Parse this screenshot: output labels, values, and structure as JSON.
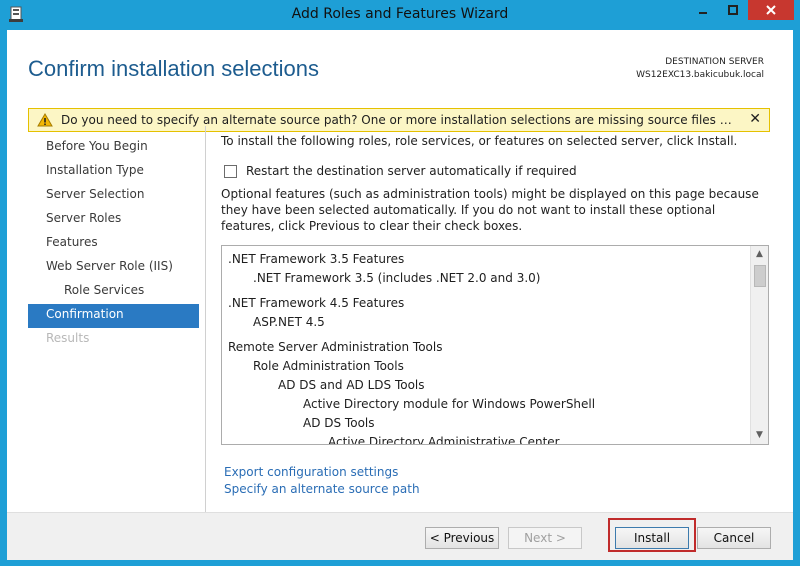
{
  "window": {
    "title": "Add Roles and Features Wizard",
    "accent_color": "#1e9fd6",
    "close_color": "#c7372f"
  },
  "header": {
    "title": "Confirm installation selections",
    "destination_label": "DESTINATION SERVER",
    "destination_server": "WS12EXC13.bakicubuk.local"
  },
  "warning": {
    "icon": "warning-triangle-icon",
    "text": "Do you need to specify an alternate source path? One or more installation selections are missing source files on the destination server.",
    "close_glyph": "✕"
  },
  "nav": {
    "items": [
      {
        "label": "Before You Begin",
        "state": "normal"
      },
      {
        "label": "Installation Type",
        "state": "normal"
      },
      {
        "label": "Server Selection",
        "state": "normal"
      },
      {
        "label": "Server Roles",
        "state": "normal"
      },
      {
        "label": "Features",
        "state": "normal"
      },
      {
        "label": "Web Server Role (IIS)",
        "state": "normal"
      },
      {
        "label": "Role Services",
        "state": "sub"
      },
      {
        "label": "Confirmation",
        "state": "active"
      },
      {
        "label": "Results",
        "state": "disabled"
      }
    ]
  },
  "main": {
    "intro": "To install the following roles, role services, or features on selected server, click Install.",
    "restart_label": "Restart the destination server automatically if required",
    "restart_checked": false,
    "optional_text": "Optional features (such as administration tools) might be displayed on this page because they have been selected automatically. If you do not want to install these optional features, click Previous to clear their check boxes.",
    "selections": [
      {
        "text": ".NET Framework 3.5 Features",
        "level": 0
      },
      {
        "text": ".NET Framework 3.5 (includes .NET 2.0 and 3.0)",
        "level": 1
      },
      {
        "text": ".NET Framework 4.5 Features",
        "level": 0
      },
      {
        "text": "ASP.NET 4.5",
        "level": 1
      },
      {
        "text": "Remote Server Administration Tools",
        "level": 0
      },
      {
        "text": "Role Administration Tools",
        "level": 1
      },
      {
        "text": "AD DS and AD LDS Tools",
        "level": 2
      },
      {
        "text": "Active Directory module for Windows PowerShell",
        "level": 3
      },
      {
        "text": "AD DS Tools",
        "level": 3
      },
      {
        "text": "Active Directory Administrative Center",
        "level": 4
      }
    ],
    "export_link": "Export configuration settings",
    "alternate_link": "Specify an alternate source path"
  },
  "footer": {
    "previous": "< Previous",
    "next": "Next >",
    "install": "Install",
    "cancel": "Cancel"
  }
}
